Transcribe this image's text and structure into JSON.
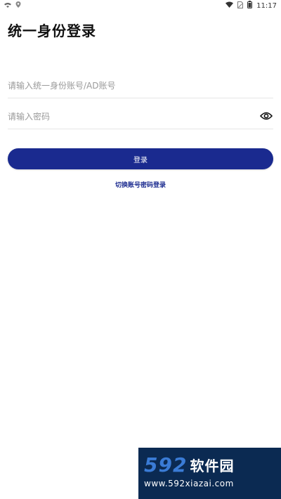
{
  "status_bar": {
    "time": "11:17",
    "left_icons": [
      "signal-icon",
      "location-icon"
    ],
    "right_icons": [
      "wifi-icon",
      "sim-icon",
      "battery-icon"
    ]
  },
  "page": {
    "title": "统一身份登录"
  },
  "form": {
    "account_placeholder": "请输入统一身份账号/AD账号",
    "password_placeholder": "请输入密码",
    "password_toggle_icon": "eye-icon"
  },
  "actions": {
    "login_label": "登录",
    "switch_label": "切换账号密码登录"
  },
  "watermark": {
    "number": "592",
    "name": "软件园",
    "url": "www.592xiazai.com"
  },
  "colors": {
    "primary": "#1a2a8f",
    "watermark_bg": "#0b2a52",
    "watermark_accent": "#3a7bd5",
    "placeholder": "#9a9a9a"
  }
}
